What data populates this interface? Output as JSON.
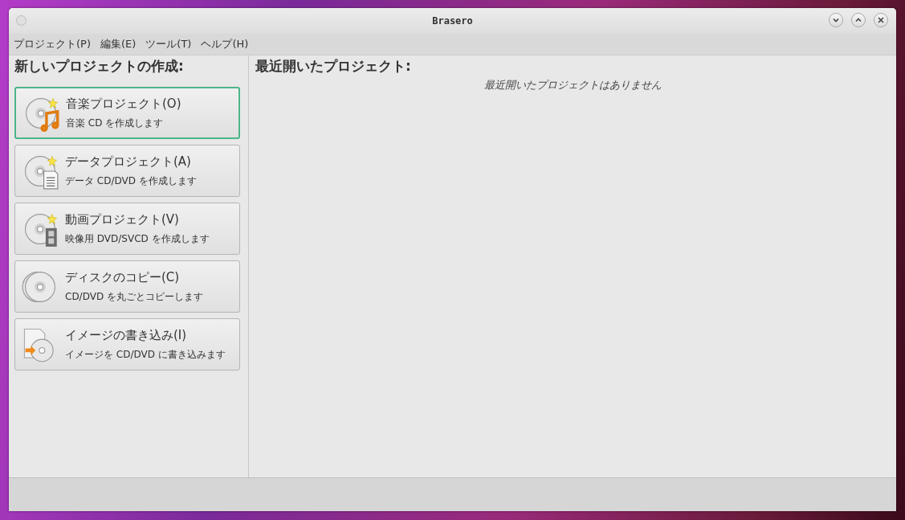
{
  "window": {
    "title": "Brasero"
  },
  "menu": [
    "プロジェクト(P)",
    "編集(E)",
    "ツール(T)",
    "ヘルプ(H)"
  ],
  "new_project": {
    "heading": "新しいプロジェクトの作成:",
    "items": [
      {
        "kind": "music",
        "title": "音楽プロジェクト(O)",
        "description": "音楽 CD を作成します",
        "selected": true
      },
      {
        "kind": "data",
        "title": "データプロジェクト(A)",
        "description": "データ CD/DVD を作成します",
        "selected": false
      },
      {
        "kind": "video",
        "title": "動画プロジェクト(V)",
        "description": "映像用 DVD/SVCD を作成します",
        "selected": false
      },
      {
        "kind": "copy",
        "title": "ディスクのコピー(C)",
        "description": "CD/DVD を丸ごとコピーします",
        "selected": false
      },
      {
        "kind": "image",
        "title": "イメージの書き込み(I)",
        "description": "イメージを CD/DVD に書き込みます",
        "selected": false
      }
    ]
  },
  "recent": {
    "heading": "最近開いたプロジェクト:",
    "empty_message": "最近開いたプロジェクトはありません"
  }
}
